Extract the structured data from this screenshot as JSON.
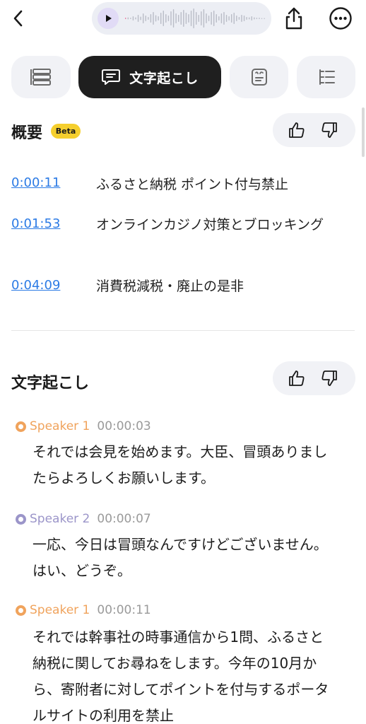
{
  "tabs": [
    {
      "icon": "list-rows-icon"
    },
    {
      "icon": "transcript-icon",
      "label": "文字起こし",
      "active": true
    },
    {
      "icon": "ai-note-icon"
    },
    {
      "icon": "outline-icon"
    }
  ],
  "summary": {
    "title": "概要",
    "badge": "Beta",
    "items": [
      {
        "time": "0:00:11",
        "text": "ふるさと納税 ポイント付与禁止"
      },
      {
        "time": "0:01:53",
        "text": "オンラインカジノ対策とブロッキング"
      },
      {
        "time": "0:04:09",
        "text": "消費税減税・廃止の是非"
      }
    ]
  },
  "transcript": {
    "title": "文字起こし",
    "entries": [
      {
        "speaker": "Speaker 1",
        "time": "00:00:03",
        "color": "#f0a35c",
        "text": "それでは会見を始めます。大臣、冒頭ありましたらよろしくお願いします。"
      },
      {
        "speaker": "Speaker 2",
        "time": "00:00:07",
        "color": "#9b95c9",
        "text": "一応、今日は冒頭なんですけどございません。はい、どうぞ。"
      },
      {
        "speaker": "Speaker 1",
        "time": "00:00:11",
        "color": "#f0a35c",
        "text": "それでは幹事社の時事通信から1問、ふるさと納税に関してお尋ねをします。今年の10月から、寄附者に対してポイントを付与するポータルサイトの利用を禁止"
      }
    ]
  },
  "colors": {
    "link": "#2c7be5",
    "active_tab": "#1f1f1f",
    "badge": "#f5cf2e"
  }
}
